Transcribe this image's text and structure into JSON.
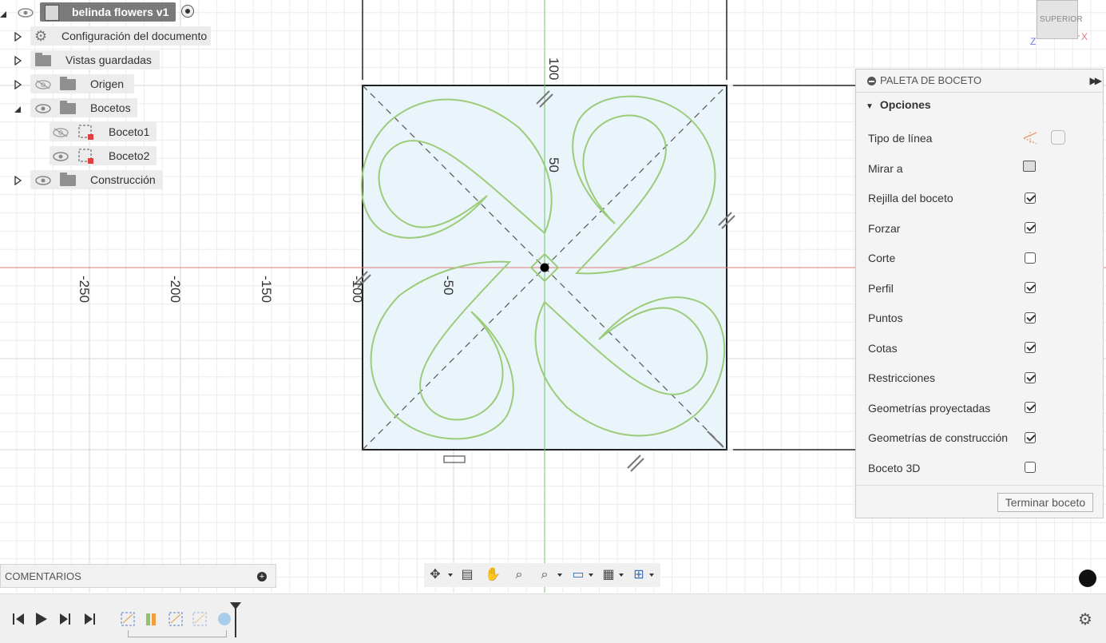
{
  "browser": {
    "root": {
      "label": "belinda flowers v1"
    },
    "items": [
      {
        "label": "Configuración del documento",
        "expanded": false,
        "icon": "gear-icon",
        "visible": null
      },
      {
        "label": "Vistas guardadas",
        "expanded": false,
        "icon": "folder-icon",
        "visible": null
      },
      {
        "label": "Origen",
        "expanded": false,
        "icon": "folder-icon",
        "visible": false
      },
      {
        "label": "Bocetos",
        "expanded": true,
        "icon": "folder-icon",
        "visible": true,
        "children": [
          {
            "label": "Boceto1",
            "visible": false,
            "icon": "sketch-icon"
          },
          {
            "label": "Boceto2",
            "visible": true,
            "icon": "sketch-icon"
          }
        ]
      },
      {
        "label": "Construcción",
        "expanded": false,
        "icon": "folder-icon",
        "visible": true
      }
    ]
  },
  "viewcube": {
    "face": "SUPERIOR",
    "axis_x": "X",
    "axis_z": "Z"
  },
  "ruler": {
    "horizontal": [
      "-250",
      "-200",
      "-150",
      "-100",
      "-50"
    ],
    "vertical": [
      "100",
      "50"
    ]
  },
  "palette": {
    "title": "PALETA DE BOCETO",
    "section": "Opciones",
    "options": [
      {
        "label": "Tipo de línea",
        "kind": "icons"
      },
      {
        "label": "Mirar a",
        "kind": "icon"
      },
      {
        "label": "Rejilla del boceto",
        "kind": "checkbox",
        "checked": true
      },
      {
        "label": "Forzar",
        "kind": "checkbox",
        "checked": true
      },
      {
        "label": "Corte",
        "kind": "checkbox",
        "checked": false
      },
      {
        "label": "Perfil",
        "kind": "checkbox",
        "checked": true
      },
      {
        "label": "Puntos",
        "kind": "checkbox",
        "checked": true
      },
      {
        "label": "Cotas",
        "kind": "checkbox",
        "checked": true
      },
      {
        "label": "Restricciones",
        "kind": "checkbox",
        "checked": true
      },
      {
        "label": "Geometrías proyectadas",
        "kind": "checkbox",
        "checked": true
      },
      {
        "label": "Geometrías de construcción",
        "kind": "checkbox",
        "checked": true
      },
      {
        "label": "Boceto 3D",
        "kind": "checkbox",
        "checked": false
      }
    ],
    "finish_button": "Terminar boceto"
  },
  "comments": {
    "label": "COMENTARIOS"
  },
  "colors": {
    "grid": "#e3e3e3",
    "x_axis": "#e07a7a",
    "y_axis": "#6cc46c",
    "sketch_fill": "#eaf4fb",
    "curve": "#9ccc7a",
    "browser_pill": "#ececec"
  }
}
